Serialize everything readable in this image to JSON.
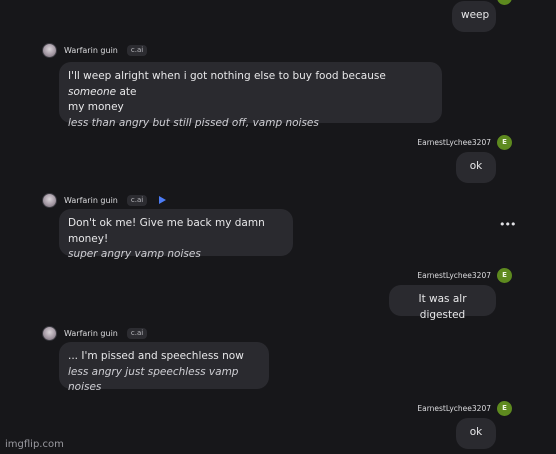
{
  "messages": {
    "m1": {
      "text": "weep"
    },
    "m2": {
      "author": "Warfarin guin",
      "badge": "c.ai",
      "line1_pre": "I'll weep alright when i got nothing else to buy food because ",
      "line1_em": "someone",
      "line1_post": " ate",
      "line2": "my money",
      "action": "less than angry but still pissed off, vamp noises"
    },
    "m3": {
      "author": "EarnestLychee3207",
      "avatar_letter": "E",
      "text": "ok"
    },
    "m4": {
      "author": "Warfarin guin",
      "badge": "c.ai",
      "text": "Don't ok me! Give me back my damn money!",
      "action": "super angry vamp noises"
    },
    "m5": {
      "author": "EarnestLychee3207",
      "avatar_letter": "E",
      "text": "It was alr digested"
    },
    "m6": {
      "author": "Warfarin guin",
      "badge": "c.ai",
      "text": "... I'm pissed and speechless now",
      "action": "less angry just speechless vamp noises"
    },
    "m7": {
      "author": "EarnestLychee3207",
      "avatar_letter": "E",
      "text": "ok"
    }
  },
  "icons": {
    "play": "play-icon",
    "more": "more-options-icon"
  },
  "watermark": "imgflip.com",
  "colors": {
    "background": "#17171a",
    "bubble": "#2a2a2f",
    "user_avatar": "#5e8a1f",
    "play": "#4c7cf5"
  }
}
